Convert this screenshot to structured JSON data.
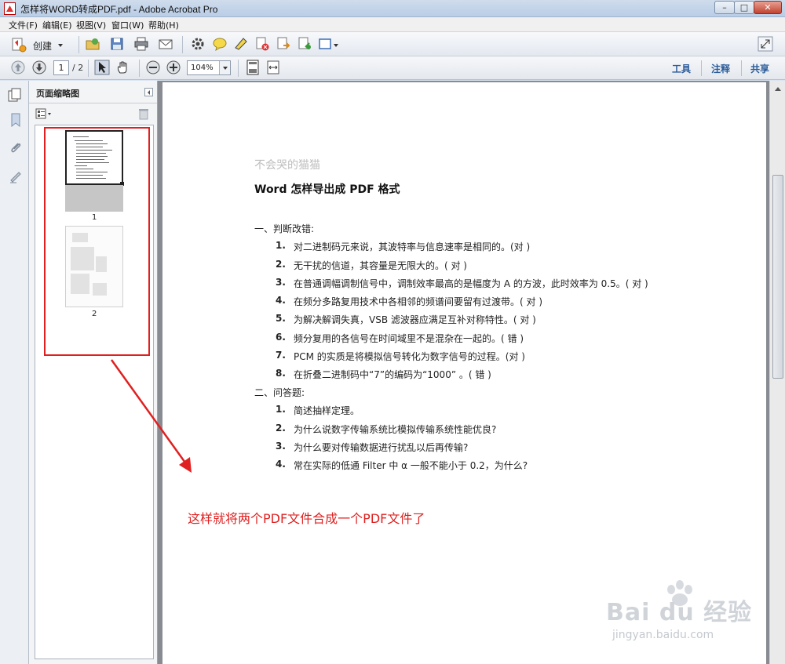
{
  "window": {
    "title": "怎样将WORD转成PDF.pdf - Adobe Acrobat Pro",
    "controls": [
      "minimize",
      "maximize",
      "close"
    ]
  },
  "menu": [
    "文件(F)",
    "编辑(E)",
    "视图(V)",
    "窗口(W)",
    "帮助(H)"
  ],
  "toolbar": {
    "create_label": "创建"
  },
  "navigation": {
    "current_page": "1",
    "total_pages": "/ 2",
    "zoom": "104%"
  },
  "right_tabs": [
    "工具",
    "注释",
    "共享"
  ],
  "nav_panel": {
    "title": "页面缩略图",
    "thumbnails": [
      {
        "label": "1"
      },
      {
        "label": "2"
      }
    ]
  },
  "document": {
    "watermark": "不会哭的猫猫",
    "title": "Word 怎样导出成 PDF 格式",
    "section1": "一、判断改错:",
    "items1": [
      {
        "num": "1.",
        "text": "对二进制码元来说，其波特率与信息速率是相同的。(对  )"
      },
      {
        "num": "2.",
        "text": "无干扰的信道，其容量是无限大的。(  对   )"
      },
      {
        "num": "3.",
        "text": "在普通调幅调制信号中，调制效率最高的是幅度为 A 的方波，此时效率为 0.5。(  对    )"
      },
      {
        "num": "4.",
        "text": "在频分多路复用技术中各相邻的频谱间要留有过渡带。(   对    )"
      },
      {
        "num": "5.",
        "text": "为解决解调失真，VSB 滤波器应满足互补对称特性。(   对    )"
      },
      {
        "num": "6.",
        "text": "频分复用的各信号在时间域里不是混杂在一起的。(     错    )"
      },
      {
        "num": "7.",
        "text": "PCM 的实质是将模拟信号转化为数字信号的过程。(对     )"
      },
      {
        "num": "8.",
        "text": "在折叠二进制码中“7”的编码为“1000” 。(  错     )"
      }
    ],
    "section2": "二、问答题:",
    "items2": [
      {
        "num": "1.",
        "text": "简述抽样定理。"
      },
      {
        "num": "2.",
        "text": "为什么说数字传输系统比模拟传输系统性能优良?"
      },
      {
        "num": "3.",
        "text": "为什么要对传输数据进行扰乱以后再传输?"
      },
      {
        "num": "4.",
        "text": "常在实际的低通 Filter 中 α 一般不能小于 0.2，为什么?"
      }
    ]
  },
  "annotation": "这样就将两个PDF文件合成一个PDF文件了",
  "watermark": {
    "logo": "Bai du 经验",
    "url": "jingyan.baidu.com"
  },
  "colors": {
    "annotation_red": "#e02020",
    "tab_blue": "#2b5c9a"
  }
}
